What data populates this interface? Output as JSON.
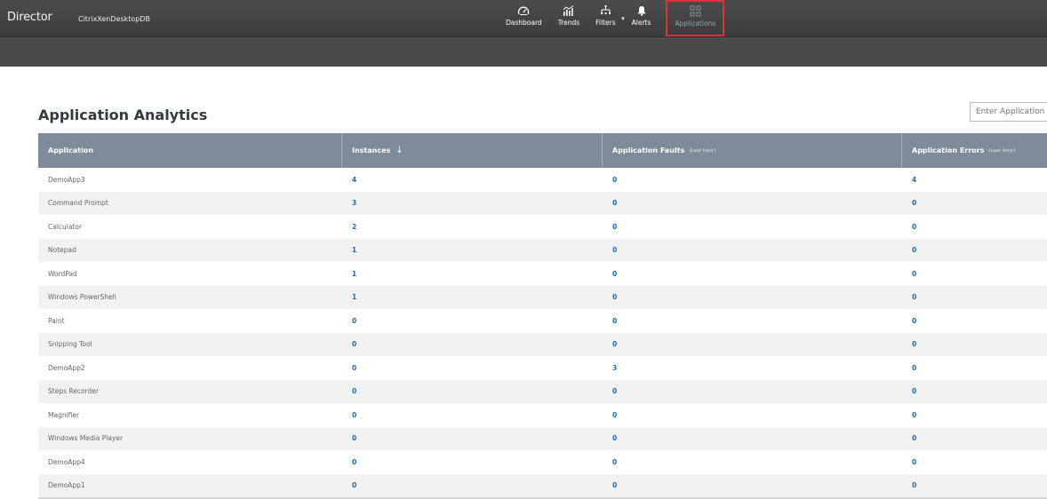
{
  "header": {
    "brand": "Director",
    "site": "CitrixXenDesktopDB",
    "nav": [
      {
        "label": "Dashboard",
        "icon": "gauge-icon"
      },
      {
        "label": "Trends",
        "icon": "trends-icon"
      },
      {
        "label": "Filters",
        "icon": "filters-icon"
      },
      {
        "label": "Alerts",
        "icon": "bell-icon"
      },
      {
        "label": "Applications",
        "icon": "grid-icon",
        "active": true
      }
    ]
  },
  "page": {
    "title": "Application Analytics",
    "search_placeholder": "Enter Application Name"
  },
  "table": {
    "columns": [
      {
        "label": "Application",
        "sub": ""
      },
      {
        "label": "Instances",
        "sub": ""
      },
      {
        "label": "Application Faults",
        "sub": "(Last hour)"
      },
      {
        "label": "Application Errors",
        "sub": "(Last hour)"
      }
    ],
    "rows": [
      {
        "app": "DemoApp3",
        "instances": "4",
        "faults": "0",
        "errors": "4"
      },
      {
        "app": "Command Prompt",
        "instances": "3",
        "faults": "0",
        "errors": "0"
      },
      {
        "app": "Calculator",
        "instances": "2",
        "faults": "0",
        "errors": "0"
      },
      {
        "app": "Notepad",
        "instances": "1",
        "faults": "0",
        "errors": "0"
      },
      {
        "app": "WordPad",
        "instances": "1",
        "faults": "0",
        "errors": "0"
      },
      {
        "app": "Windows PowerShell",
        "instances": "1",
        "faults": "0",
        "errors": "0"
      },
      {
        "app": "Paint",
        "instances": "0",
        "faults": "0",
        "errors": "0"
      },
      {
        "app": "Snipping Tool",
        "instances": "0",
        "faults": "0",
        "errors": "0"
      },
      {
        "app": "DemoApp2",
        "instances": "0",
        "faults": "3",
        "errors": "0"
      },
      {
        "app": "Steps Recorder",
        "instances": "0",
        "faults": "0",
        "errors": "0"
      },
      {
        "app": "Magnifier",
        "instances": "0",
        "faults": "0",
        "errors": "0"
      },
      {
        "app": "Windows Media Player",
        "instances": "0",
        "faults": "0",
        "errors": "0"
      },
      {
        "app": "DemoApp4",
        "instances": "0",
        "faults": "0",
        "errors": "0"
      },
      {
        "app": "DemoApp1",
        "instances": "0",
        "faults": "0",
        "errors": "0"
      }
    ]
  }
}
